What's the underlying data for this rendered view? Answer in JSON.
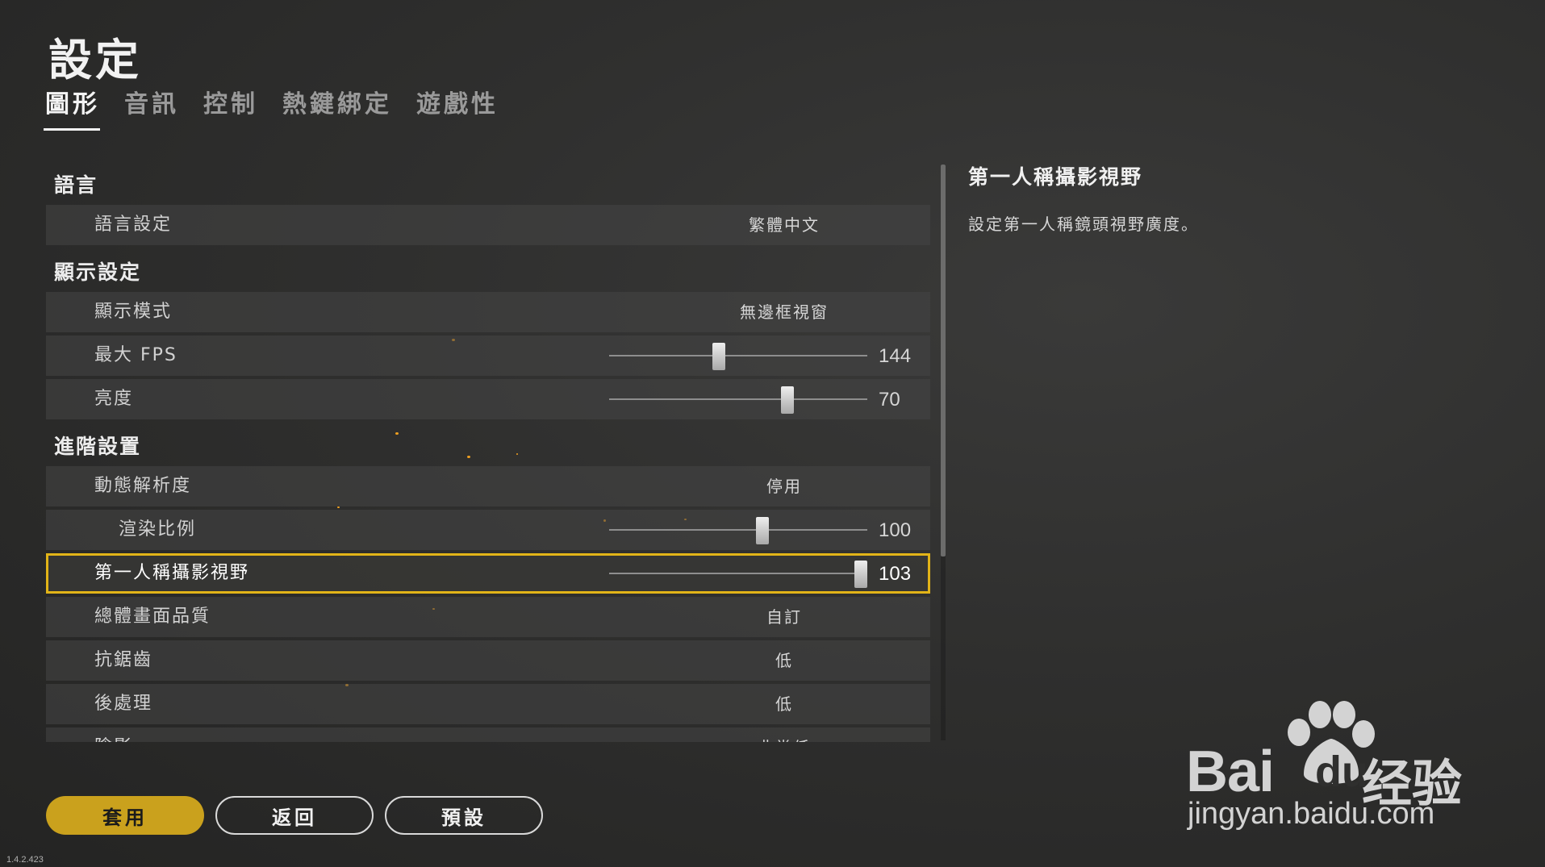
{
  "header": {
    "title": "設定"
  },
  "tabs": [
    {
      "label": "圖形",
      "active": true
    },
    {
      "label": "音訊",
      "active": false
    },
    {
      "label": "控制",
      "active": false
    },
    {
      "label": "熱鍵綁定",
      "active": false
    },
    {
      "label": "遊戲性",
      "active": false
    }
  ],
  "sections": {
    "language": {
      "title": "語言",
      "language_setting": {
        "label": "語言設定",
        "value": "繁體中文"
      }
    },
    "display": {
      "title": "顯示設定",
      "display_mode": {
        "label": "顯示模式",
        "value": "無邊框視窗"
      },
      "max_fps": {
        "label": "最大 FPS",
        "value": "144",
        "level": 0.42
      },
      "brightness": {
        "label": "亮度",
        "value": "70",
        "level": 0.7
      }
    },
    "advanced": {
      "title": "進階設置",
      "dynamic_resolution": {
        "label": "動態解析度",
        "value": "停用"
      },
      "render_scale": {
        "label": "渲染比例",
        "value": "100",
        "level": 0.6
      },
      "fpp_fov": {
        "label": "第一人稱攝影視野",
        "value": "103",
        "level": 1.0
      },
      "overall_quality": {
        "label": "總體畫面品質",
        "value": "自訂"
      },
      "anti_aliasing": {
        "label": "抗鋸齒",
        "value": "低"
      },
      "post_processing": {
        "label": "後處理",
        "value": "低"
      },
      "shadows": {
        "label": "陰影",
        "value": "非常低"
      }
    }
  },
  "detail": {
    "title": "第一人稱攝影視野",
    "description": "設定第一人稱鏡頭視野廣度。"
  },
  "buttons": {
    "apply": "套用",
    "back": "返回",
    "default": "預設"
  },
  "version": "1.4.2.423",
  "watermark": {
    "bai": "Bai",
    "du": "du",
    "cn": "经验",
    "url": "jingyan.baidu.com"
  },
  "colors": {
    "accent": "#e2b418",
    "apply_button": "#caa11d",
    "ember": "#f0a020"
  }
}
